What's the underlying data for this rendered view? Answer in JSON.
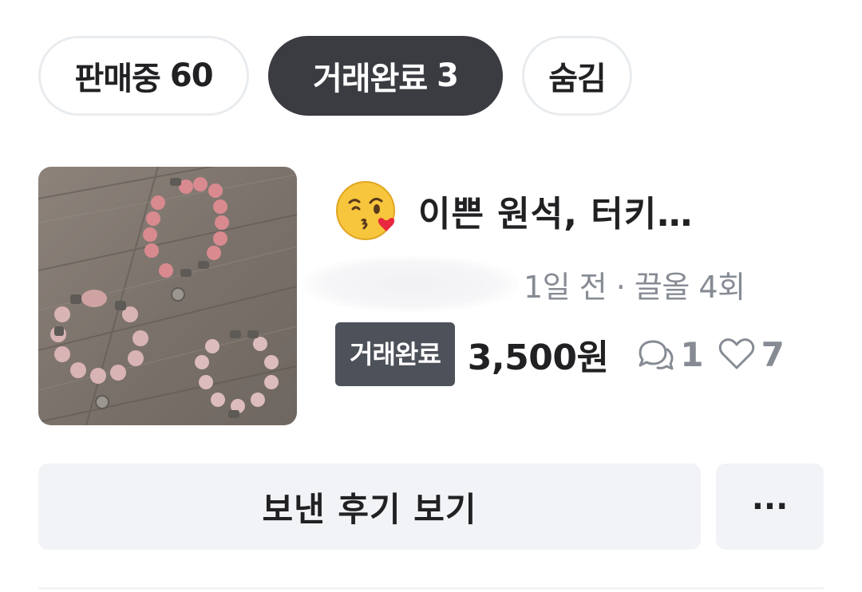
{
  "tabs": [
    {
      "label": "판매중",
      "count": "60",
      "active": false
    },
    {
      "label": "거래완료",
      "count": "3",
      "active": true
    },
    {
      "label": "숨김",
      "count": "",
      "active": false
    }
  ],
  "item": {
    "title_emoji_icon": "face-blowing-kiss-emoji",
    "title": "이쁜 원석, 터키…",
    "meta": "1일 전 · 끌올 4회",
    "status_badge": "거래완료",
    "price": "3,500원",
    "chat_count": "1",
    "like_count": "7",
    "icons": {
      "chat": "chat-bubbles-icon",
      "like": "heart-outline-icon"
    }
  },
  "actions": {
    "review_label": "보낸 후기 보기",
    "more_label": "···"
  },
  "colors": {
    "active_tab_bg": "#3a3c41",
    "badge_bg": "#4d5159",
    "muted_text": "#868b94",
    "button_bg": "#f2f3f6"
  }
}
